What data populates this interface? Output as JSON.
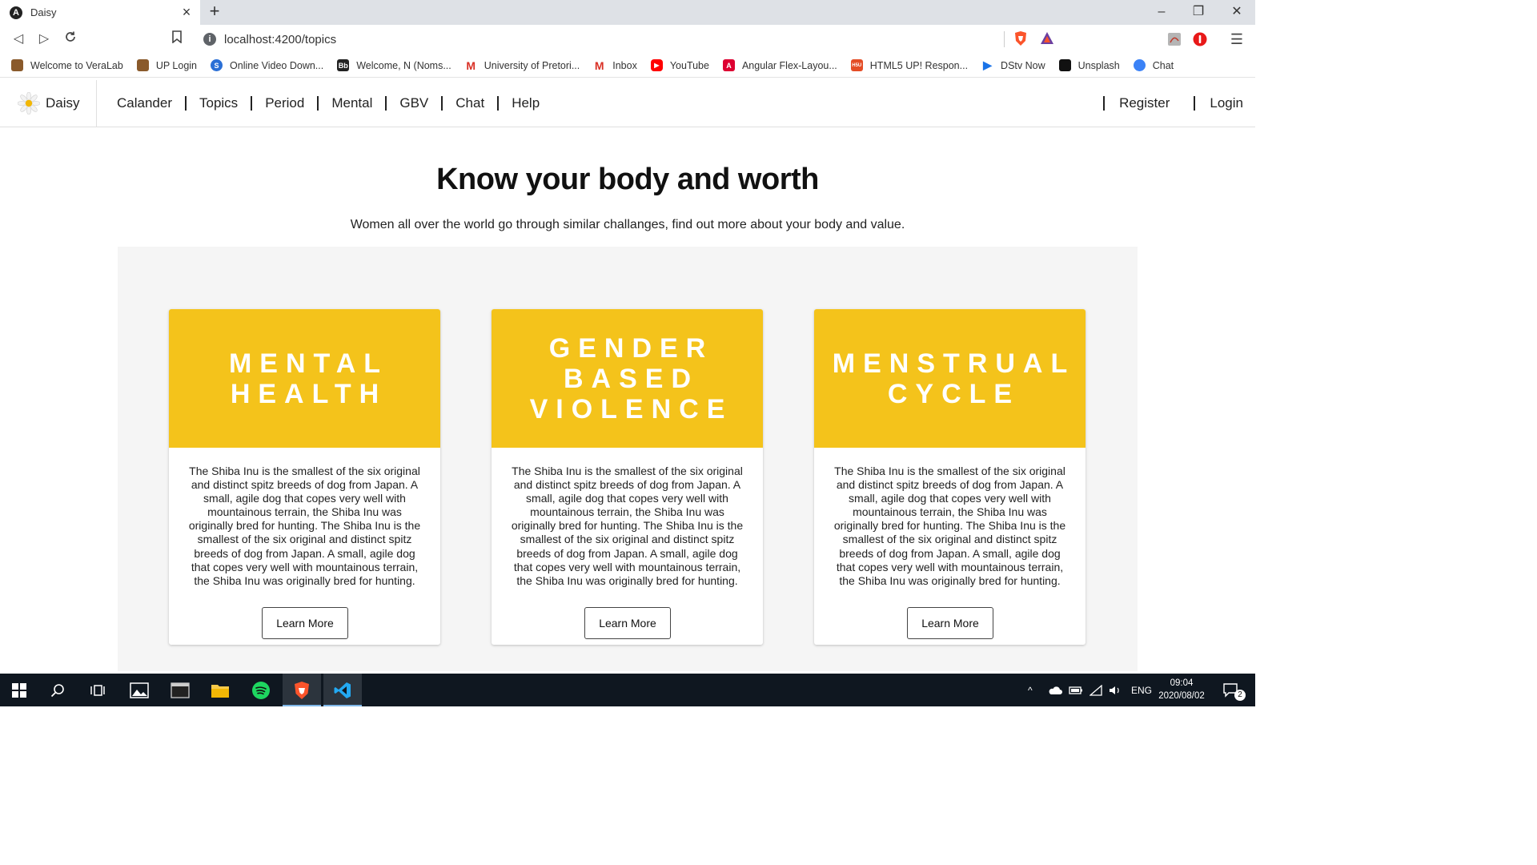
{
  "browser": {
    "tab_title": "Daisy",
    "tab_favicon": "A",
    "url": "localhost:4200/topics",
    "bookmarks": [
      {
        "label": "Welcome to VeraLab",
        "icon": "veralab-icon",
        "color": "#8a5a2b"
      },
      {
        "label": "UP Login",
        "icon": "up-icon",
        "color": "#8a5a2b"
      },
      {
        "label": "Online Video Down...",
        "icon": "savefrom-icon",
        "color": "#2a6fd6"
      },
      {
        "label": "Welcome, N (Noms...",
        "icon": "blackboard-icon",
        "color": "#222222"
      },
      {
        "label": "University of Pretori...",
        "icon": "gmail-icon",
        "color": "#d93025"
      },
      {
        "label": "Inbox",
        "icon": "gmail-icon",
        "color": "#d93025"
      },
      {
        "label": "YouTube",
        "icon": "youtube-icon",
        "color": "#ff0000"
      },
      {
        "label": "Angular Flex-Layou...",
        "icon": "angular-icon",
        "color": "#dd0031"
      },
      {
        "label": "HTML5 UP! Respon...",
        "icon": "html5up-icon",
        "color": "#e44d26"
      },
      {
        "label": "DStv Now",
        "icon": "dstv-icon",
        "color": "#1a73e8"
      },
      {
        "label": "Unsplash",
        "icon": "unsplash-icon",
        "color": "#111111"
      },
      {
        "label": "Chat",
        "icon": "chat-icon",
        "color": "#3b82f6"
      }
    ]
  },
  "nav": {
    "brand": "Daisy",
    "links": [
      "Calander",
      "Topics",
      "Period",
      "Mental",
      "GBV",
      "Chat",
      "Help"
    ],
    "register": "Register",
    "login": "Login"
  },
  "main": {
    "title": "Know your body and worth",
    "subtitle": "Women all over the world go through similar challanges, find out more about your body and value.",
    "cards": [
      {
        "banner": [
          "MENTAL",
          "HEALTH"
        ],
        "text": "The Shiba Inu is the smallest of the six original and distinct spitz breeds of dog from Japan. A small, agile dog that copes very well with mountainous terrain, the Shiba Inu was originally bred for hunting. The Shiba Inu is the smallest of the six original and distinct spitz breeds of dog from Japan. A small, agile dog that copes very well with mountainous terrain, the Shiba Inu was originally bred for hunting.",
        "button": "Learn More"
      },
      {
        "banner": [
          "GENDER",
          "BASED",
          "VIOLENCE"
        ],
        "text": "The Shiba Inu is the smallest of the six original and distinct spitz breeds of dog from Japan. A small, agile dog that copes very well with mountainous terrain, the Shiba Inu was originally bred for hunting. The Shiba Inu is the smallest of the six original and distinct spitz breeds of dog from Japan. A small, agile dog that copes very well with mountainous terrain, the Shiba Inu was originally bred for hunting.",
        "button": "Learn More"
      },
      {
        "banner": [
          "MENSTRUAL",
          "CYCLE"
        ],
        "text": "The Shiba Inu is the smallest of the six original and distinct spitz breeds of dog from Japan. A small, agile dog that copes very well with mountainous terrain, the Shiba Inu was originally bred for hunting. The Shiba Inu is the smallest of the six original and distinct spitz breeds of dog from Japan. A small, agile dog that copes very well with mountainous terrain, the Shiba Inu was originally bred for hunting.",
        "button": "Learn More"
      }
    ]
  },
  "colors": {
    "banner": "#f4c31b",
    "panel": "#f5f5f5",
    "taskbar": "#0f1720"
  },
  "taskbar": {
    "language": "ENG",
    "time": "09:04",
    "date": "2020/08/02",
    "notifications": "2"
  }
}
